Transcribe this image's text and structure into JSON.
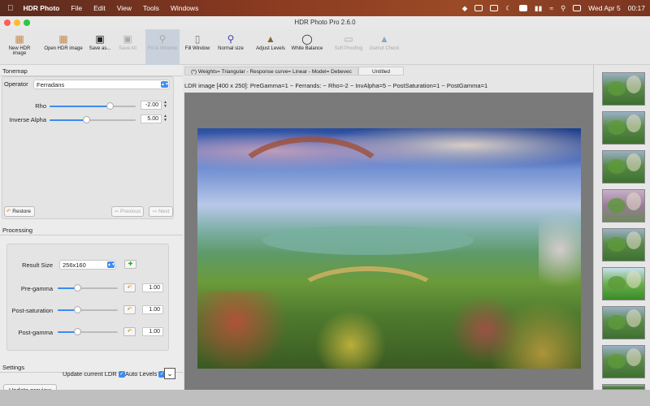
{
  "menubar": {
    "app_name": "HDR Photo",
    "items": [
      "File",
      "Edit",
      "View",
      "Tools",
      "Windows"
    ],
    "datetime": "Wed Apr 5",
    "time": "00:17"
  },
  "window": {
    "title": "HDR Photo Pro 2.6.0"
  },
  "toolbar": {
    "items": [
      {
        "label": "New HDR image",
        "icon": "image-icon",
        "enabled": true
      },
      {
        "label": "Open HDR image",
        "icon": "folder-image-icon",
        "enabled": true
      },
      {
        "label": "Save as...",
        "icon": "floppy-icon",
        "enabled": true
      },
      {
        "label": "Save All",
        "icon": "floppy-multi-icon",
        "enabled": false
      },
      {
        "label": "Fit to Window",
        "icon": "zoom-fit-icon",
        "enabled": false
      },
      {
        "label": "Fill Window",
        "icon": "fill-icon",
        "enabled": true
      },
      {
        "label": "Normal size",
        "icon": "zoom-icon",
        "enabled": true
      },
      {
        "label": "Adjust Levels",
        "icon": "levels-icon",
        "enabled": true
      },
      {
        "label": "White Balance",
        "icon": "drop-icon",
        "enabled": true
      },
      {
        "label": "Soft Proofing",
        "icon": "monitor-icon",
        "enabled": false
      },
      {
        "label": "Gamut Check",
        "icon": "gamut-icon",
        "enabled": false
      }
    ]
  },
  "tonemap": {
    "header": "Tonemap",
    "operator_label": "Operator",
    "operator_value": "Ferradans",
    "params": [
      {
        "label": "Rho",
        "value": "-2.00",
        "fill": 0.7
      },
      {
        "label": "Inverse Alpha",
        "value": "5.00",
        "fill": 0.42
      }
    ],
    "restore_label": "Restore",
    "previous_label": "Previous",
    "next_label": "Next"
  },
  "processing": {
    "header": "Processing",
    "result_size_label": "Result Size",
    "result_size_value": "256x160",
    "params": [
      {
        "label": "Pre-gamma",
        "value": "1.00",
        "fill": 0.32
      },
      {
        "label": "Post-saturation",
        "value": "1.00",
        "fill": 0.32
      },
      {
        "label": "Post-gamma",
        "value": "1.00",
        "fill": 0.32
      }
    ]
  },
  "settings": {
    "header": "Settings",
    "update_preview_label": "Update preview",
    "update_current_label": "Update current LDR",
    "auto_levels_label": "Auto Levels"
  },
  "tabs": [
    {
      "label": "(*) Weights= Triangular - Response curve= Linear - Model= Debevec",
      "active": false
    },
    {
      "label": "Untitled",
      "active": true
    }
  ],
  "image_info": "LDR image [400 x 250]: PreGamma=1 ~ Ferrands: ~ Rho=-2 ~ InvAlpha=5 ~ PostSaturation=1 ~ PostGamma=1",
  "thumbnails": 8
}
